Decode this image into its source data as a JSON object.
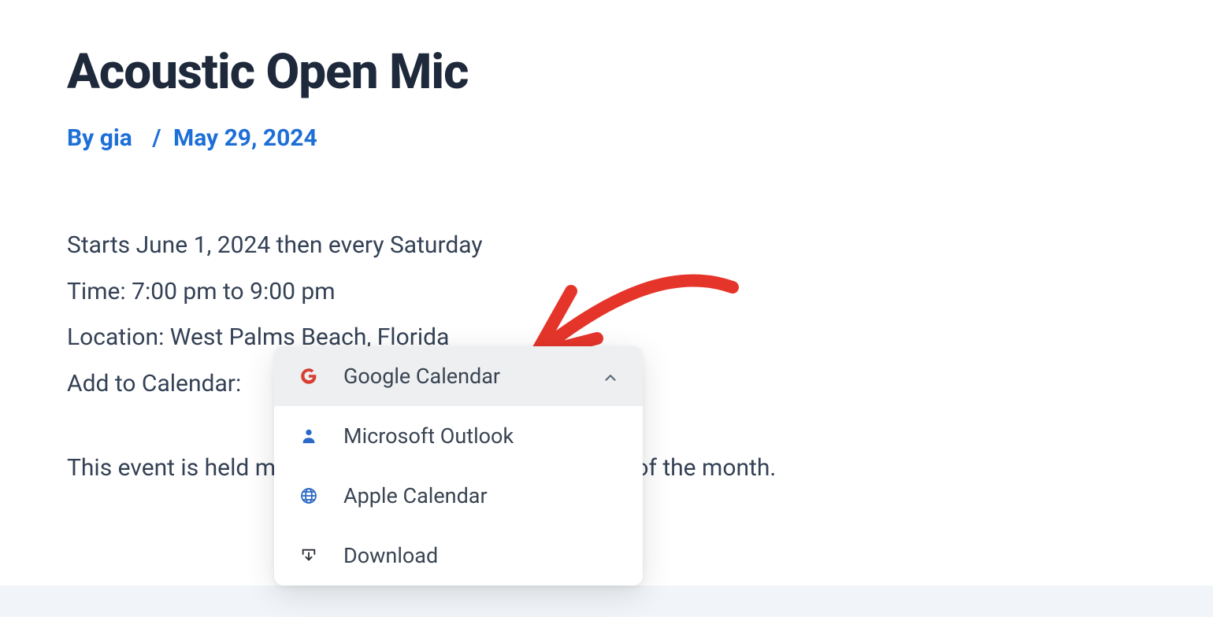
{
  "page": {
    "title": "Acoustic Open Mic"
  },
  "byline": {
    "prefix": "By",
    "author": "gia",
    "separator": "/",
    "date": "May 29, 2024"
  },
  "event": {
    "schedule": "Starts June 1, 2024 then every Saturday",
    "time_label": "Time:",
    "time_value": "7:00 pm to 9:00 pm",
    "location_label": "Location:",
    "location_value": "West Palms Beach, Florida",
    "add_label": "Add to Calendar:",
    "description": "This event is held monthly on the first and second day of the month."
  },
  "calendar_dropdown": {
    "items": [
      {
        "icon": "google",
        "label": "Google Calendar",
        "active": true
      },
      {
        "icon": "outlook",
        "label": "Microsoft Outlook",
        "active": false
      },
      {
        "icon": "globe",
        "label": "Apple Calendar",
        "active": false
      },
      {
        "icon": "download",
        "label": "Download",
        "active": false
      }
    ]
  },
  "colors": {
    "accent": "#1d6fd8",
    "text_dark": "#1e293b",
    "text_body": "#344155",
    "annotation": "#e5352b"
  }
}
